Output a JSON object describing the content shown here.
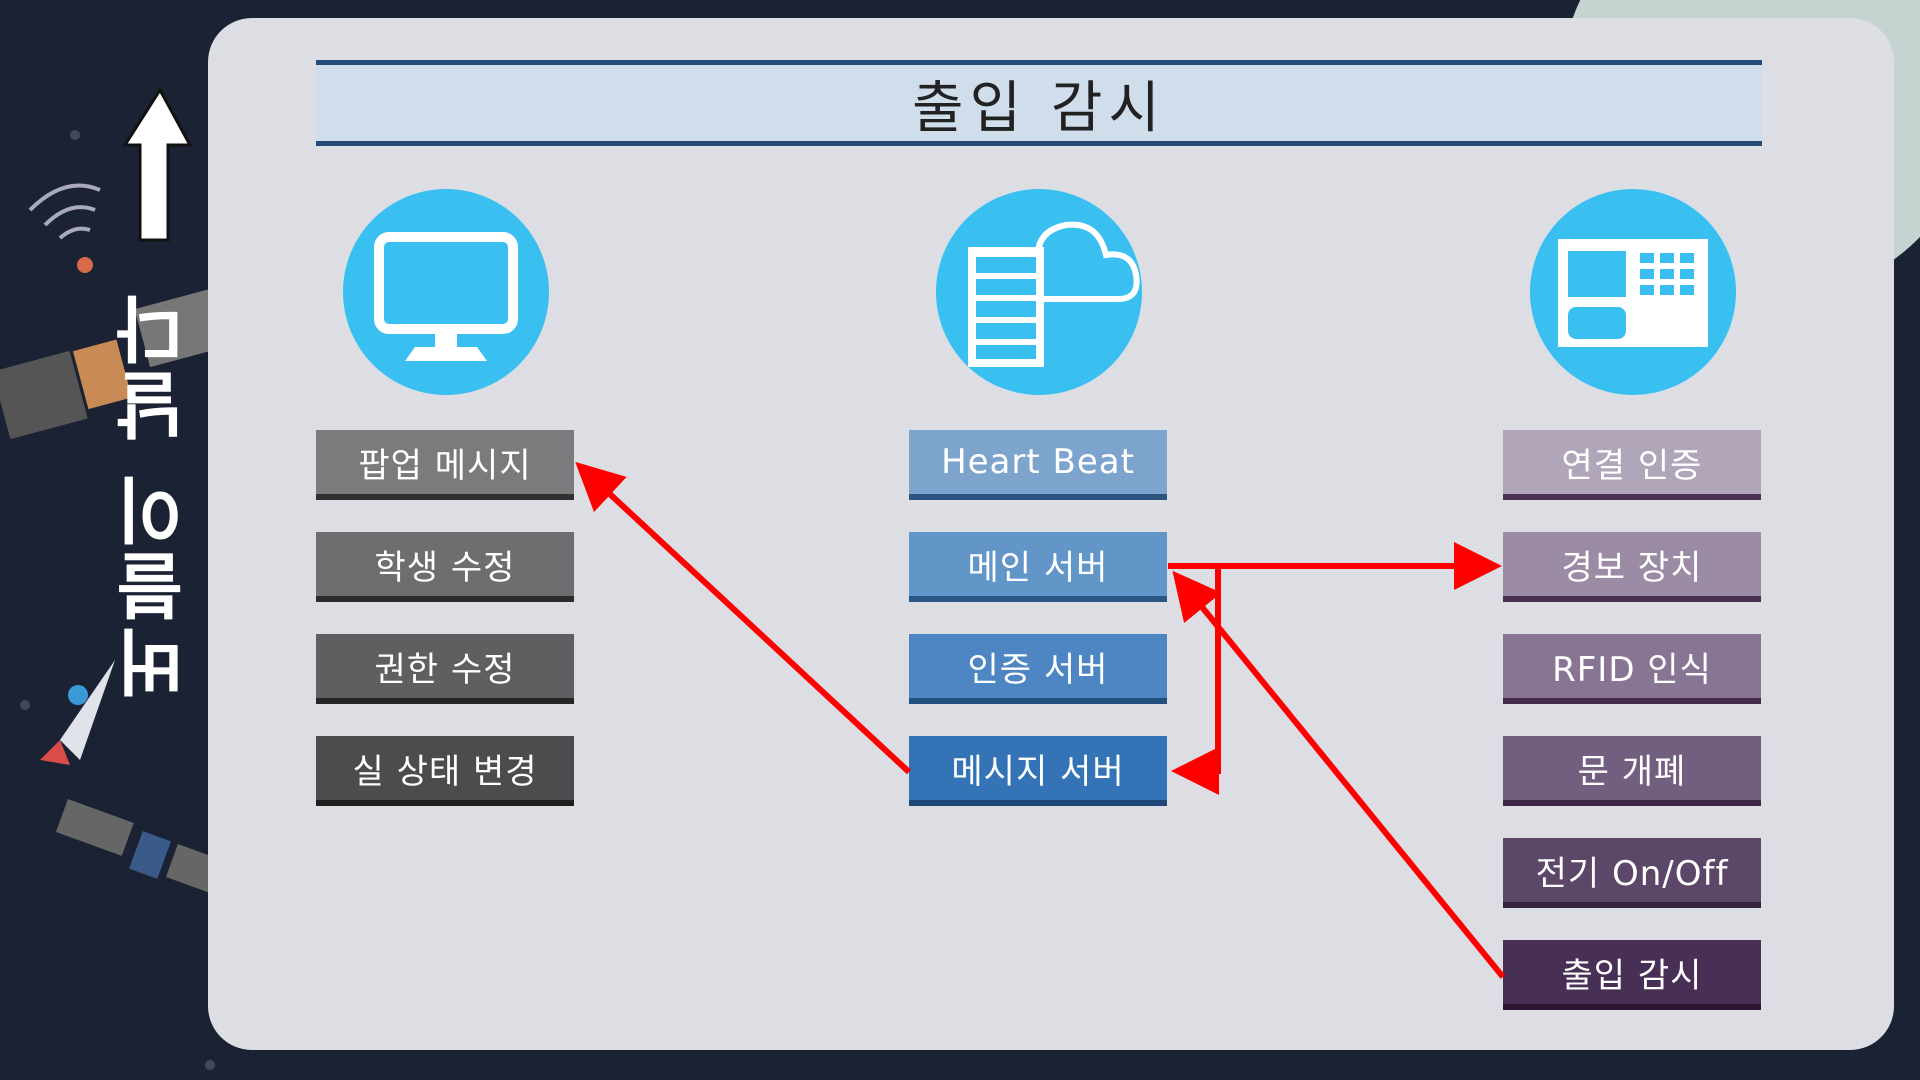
{
  "slide_title": "출입 감시",
  "side_title": "버블이 날다",
  "columns": {
    "client": {
      "icon": "monitor-icon",
      "items": [
        "팝업 메시지",
        "학생 수정",
        "권한 수정",
        "실 상태 변경"
      ]
    },
    "server": {
      "icon": "server-cloud-icon",
      "items": [
        "Heart Beat",
        "메인 서버",
        "인증 서버",
        "메시지 서버"
      ]
    },
    "device": {
      "icon": "control-panel-icon",
      "items": [
        "연결 인증",
        "경보 장치",
        "RFID 인식",
        "문 개폐",
        "전기 On/Off",
        "출입 감시"
      ]
    }
  },
  "colors": {
    "arrow": "#ff0000",
    "icon_circle": "#39c0f0",
    "title_border": "#274b78"
  }
}
